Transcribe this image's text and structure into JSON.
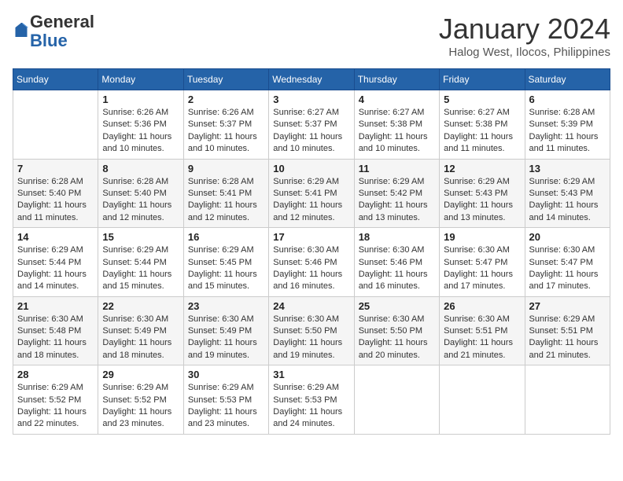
{
  "header": {
    "logo_general": "General",
    "logo_blue": "Blue",
    "month_title": "January 2024",
    "location": "Halog West, Ilocos, Philippines"
  },
  "weekdays": [
    "Sunday",
    "Monday",
    "Tuesday",
    "Wednesday",
    "Thursday",
    "Friday",
    "Saturday"
  ],
  "weeks": [
    [
      {
        "day": "",
        "text": ""
      },
      {
        "day": "1",
        "text": "Sunrise: 6:26 AM\nSunset: 5:36 PM\nDaylight: 11 hours\nand 10 minutes."
      },
      {
        "day": "2",
        "text": "Sunrise: 6:26 AM\nSunset: 5:37 PM\nDaylight: 11 hours\nand 10 minutes."
      },
      {
        "day": "3",
        "text": "Sunrise: 6:27 AM\nSunset: 5:37 PM\nDaylight: 11 hours\nand 10 minutes."
      },
      {
        "day": "4",
        "text": "Sunrise: 6:27 AM\nSunset: 5:38 PM\nDaylight: 11 hours\nand 10 minutes."
      },
      {
        "day": "5",
        "text": "Sunrise: 6:27 AM\nSunset: 5:38 PM\nDaylight: 11 hours\nand 11 minutes."
      },
      {
        "day": "6",
        "text": "Sunrise: 6:28 AM\nSunset: 5:39 PM\nDaylight: 11 hours\nand 11 minutes."
      }
    ],
    [
      {
        "day": "7",
        "text": "Sunrise: 6:28 AM\nSunset: 5:40 PM\nDaylight: 11 hours\nand 11 minutes."
      },
      {
        "day": "8",
        "text": "Sunrise: 6:28 AM\nSunset: 5:40 PM\nDaylight: 11 hours\nand 12 minutes."
      },
      {
        "day": "9",
        "text": "Sunrise: 6:28 AM\nSunset: 5:41 PM\nDaylight: 11 hours\nand 12 minutes."
      },
      {
        "day": "10",
        "text": "Sunrise: 6:29 AM\nSunset: 5:41 PM\nDaylight: 11 hours\nand 12 minutes."
      },
      {
        "day": "11",
        "text": "Sunrise: 6:29 AM\nSunset: 5:42 PM\nDaylight: 11 hours\nand 13 minutes."
      },
      {
        "day": "12",
        "text": "Sunrise: 6:29 AM\nSunset: 5:43 PM\nDaylight: 11 hours\nand 13 minutes."
      },
      {
        "day": "13",
        "text": "Sunrise: 6:29 AM\nSunset: 5:43 PM\nDaylight: 11 hours\nand 14 minutes."
      }
    ],
    [
      {
        "day": "14",
        "text": "Sunrise: 6:29 AM\nSunset: 5:44 PM\nDaylight: 11 hours\nand 14 minutes."
      },
      {
        "day": "15",
        "text": "Sunrise: 6:29 AM\nSunset: 5:44 PM\nDaylight: 11 hours\nand 15 minutes."
      },
      {
        "day": "16",
        "text": "Sunrise: 6:29 AM\nSunset: 5:45 PM\nDaylight: 11 hours\nand 15 minutes."
      },
      {
        "day": "17",
        "text": "Sunrise: 6:30 AM\nSunset: 5:46 PM\nDaylight: 11 hours\nand 16 minutes."
      },
      {
        "day": "18",
        "text": "Sunrise: 6:30 AM\nSunset: 5:46 PM\nDaylight: 11 hours\nand 16 minutes."
      },
      {
        "day": "19",
        "text": "Sunrise: 6:30 AM\nSunset: 5:47 PM\nDaylight: 11 hours\nand 17 minutes."
      },
      {
        "day": "20",
        "text": "Sunrise: 6:30 AM\nSunset: 5:47 PM\nDaylight: 11 hours\nand 17 minutes."
      }
    ],
    [
      {
        "day": "21",
        "text": "Sunrise: 6:30 AM\nSunset: 5:48 PM\nDaylight: 11 hours\nand 18 minutes."
      },
      {
        "day": "22",
        "text": "Sunrise: 6:30 AM\nSunset: 5:49 PM\nDaylight: 11 hours\nand 18 minutes."
      },
      {
        "day": "23",
        "text": "Sunrise: 6:30 AM\nSunset: 5:49 PM\nDaylight: 11 hours\nand 19 minutes."
      },
      {
        "day": "24",
        "text": "Sunrise: 6:30 AM\nSunset: 5:50 PM\nDaylight: 11 hours\nand 19 minutes."
      },
      {
        "day": "25",
        "text": "Sunrise: 6:30 AM\nSunset: 5:50 PM\nDaylight: 11 hours\nand 20 minutes."
      },
      {
        "day": "26",
        "text": "Sunrise: 6:30 AM\nSunset: 5:51 PM\nDaylight: 11 hours\nand 21 minutes."
      },
      {
        "day": "27",
        "text": "Sunrise: 6:29 AM\nSunset: 5:51 PM\nDaylight: 11 hours\nand 21 minutes."
      }
    ],
    [
      {
        "day": "28",
        "text": "Sunrise: 6:29 AM\nSunset: 5:52 PM\nDaylight: 11 hours\nand 22 minutes."
      },
      {
        "day": "29",
        "text": "Sunrise: 6:29 AM\nSunset: 5:52 PM\nDaylight: 11 hours\nand 23 minutes."
      },
      {
        "day": "30",
        "text": "Sunrise: 6:29 AM\nSunset: 5:53 PM\nDaylight: 11 hours\nand 23 minutes."
      },
      {
        "day": "31",
        "text": "Sunrise: 6:29 AM\nSunset: 5:53 PM\nDaylight: 11 hours\nand 24 minutes."
      },
      {
        "day": "",
        "text": ""
      },
      {
        "day": "",
        "text": ""
      },
      {
        "day": "",
        "text": ""
      }
    ]
  ]
}
